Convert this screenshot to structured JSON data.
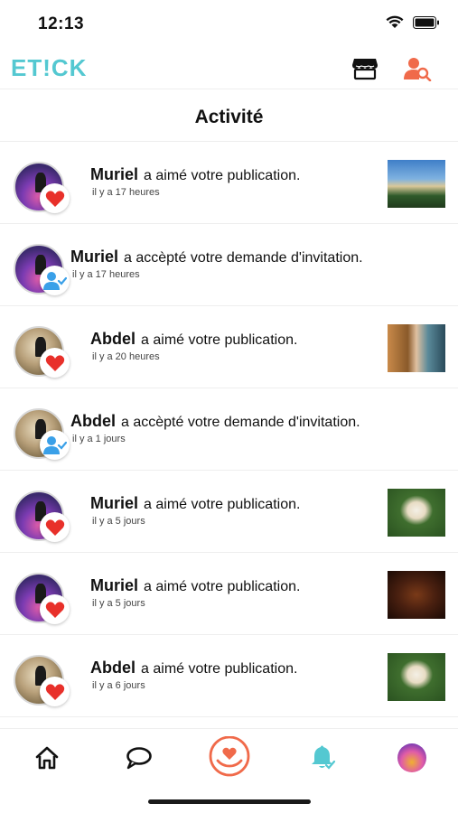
{
  "status_bar": {
    "time": "12:13"
  },
  "app_bar": {
    "logo": "ET!CK",
    "shop_icon": "store-icon",
    "search_user_icon": "user-search-icon"
  },
  "page": {
    "title": "Activité"
  },
  "activities": [
    {
      "name": "Muriel",
      "action": "a aimé votre publication.",
      "time": "il y a 17 heures",
      "type": "like",
      "avatar": "balloon",
      "thumb": "landscape"
    },
    {
      "name": "Muriel",
      "action": "a accèpté votre demande d'invitation.",
      "time": "il y a 17 heures",
      "type": "invite",
      "avatar": "balloon",
      "thumb": ""
    },
    {
      "name": "Abdel",
      "action": "a aimé votre publication.",
      "time": "il y a 20 heures",
      "type": "like",
      "avatar": "dancer",
      "thumb": "cat"
    },
    {
      "name": "Abdel",
      "action": "a accèpté votre demande d'invitation.",
      "time": "il y a 1 jours",
      "type": "invite",
      "avatar": "dancer",
      "thumb": ""
    },
    {
      "name": "Muriel",
      "action": "a aimé votre publication.",
      "time": "il y a 5 jours",
      "type": "like",
      "avatar": "balloon",
      "thumb": "dog"
    },
    {
      "name": "Muriel",
      "action": "a aimé votre publication.",
      "time": "il y a 5 jours",
      "type": "like",
      "avatar": "balloon",
      "thumb": "dark"
    },
    {
      "name": "Abdel",
      "action": "a aimé votre publication.",
      "time": "il y a 6 jours",
      "type": "like",
      "avatar": "dancer",
      "thumb": "dog"
    }
  ],
  "bottom_nav": [
    {
      "icon": "home-icon"
    },
    {
      "icon": "chat-icon"
    },
    {
      "icon": "heart-hand-icon"
    },
    {
      "icon": "notification-bell-icon",
      "active": true
    },
    {
      "icon": "profile-avatar-icon"
    }
  ],
  "colors": {
    "accent": "#54c8d1",
    "like": "#e8302a",
    "brand_orange": "#f06a4a",
    "invite_blue": "#3aa0e8"
  }
}
